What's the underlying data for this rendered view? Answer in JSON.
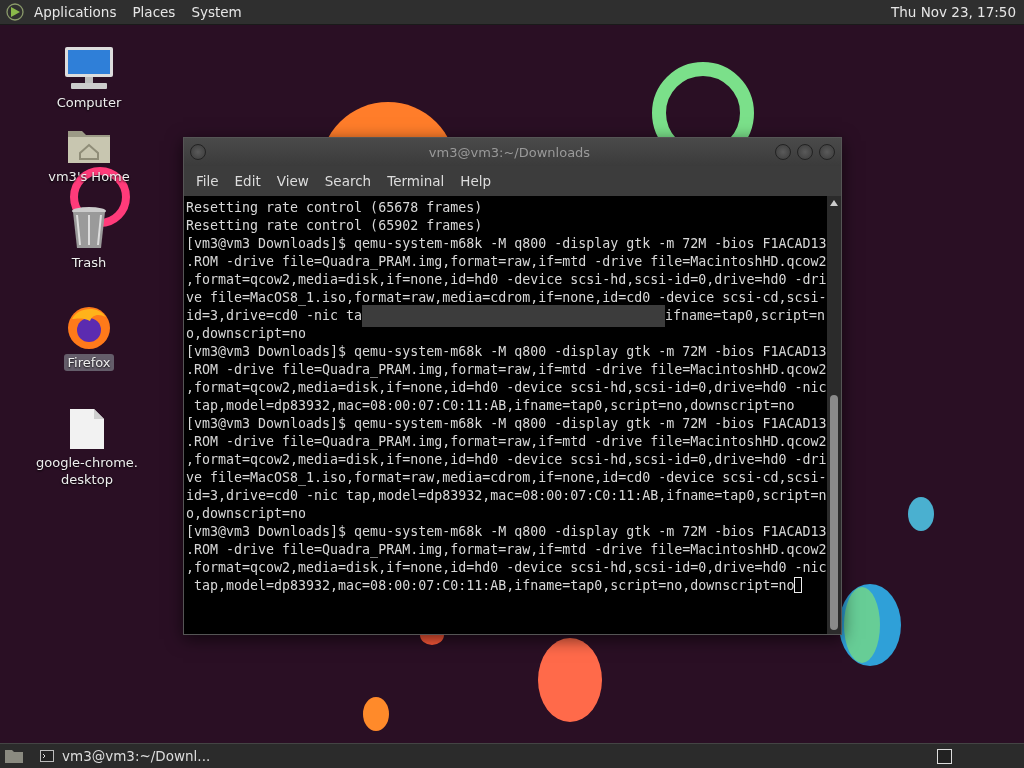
{
  "top_panel": {
    "menus": [
      {
        "label": "Applications"
      },
      {
        "label": "Places"
      },
      {
        "label": "System"
      }
    ],
    "clock": "Thu Nov 23, 17:50"
  },
  "desktop_icons": [
    {
      "label": "Computer",
      "kind": "computer",
      "selected": false
    },
    {
      "label": "vm3's Home",
      "kind": "home",
      "selected": false
    },
    {
      "label": "Trash",
      "kind": "trash",
      "selected": false
    },
    {
      "label": "Firefox",
      "kind": "browser",
      "selected": true
    },
    {
      "label": "google-chrome.\ndesktop",
      "kind": "file",
      "selected": false
    }
  ],
  "terminal": {
    "title": "vm3@vm3:~/Downloads",
    "menu": [
      {
        "label": "File"
      },
      {
        "label": "Edit"
      },
      {
        "label": "View"
      },
      {
        "label": "Search"
      },
      {
        "label": "Terminal"
      },
      {
        "label": "Help"
      }
    ],
    "lines": [
      {
        "kind": "text",
        "text": "Resetting rate control (65678 frames)"
      },
      {
        "kind": "text",
        "text": "Resetting rate control (65902 frames)"
      },
      {
        "kind": "text",
        "text": "[vm3@vm3 Downloads]$ qemu-system-m68k -M q800 -display gtk -m 72M -bios F1ACAD13"
      },
      {
        "kind": "text",
        "text": ".ROM -drive file=Quadra_PRAM.img,format=raw,if=mtd -drive file=MacintoshHD.qcow2"
      },
      {
        "kind": "text",
        "text": ",format=qcow2,media=disk,if=none,id=hd0 -device scsi-hd,scsi-id=0,drive=hd0 -dri"
      },
      {
        "kind": "text",
        "text": "ve file=MacOS8_1.iso,format=raw,media=cdrom,if=none,id=cd0 -device scsi-cd,scsi-"
      },
      {
        "kind": "redacted",
        "before": "id=3,drive=cd0 -nic ta",
        "after": "ifname=tap0,script=n"
      },
      {
        "kind": "text",
        "text": "o,downscript=no"
      },
      {
        "kind": "text",
        "text": "[vm3@vm3 Downloads]$ qemu-system-m68k -M q800 -display gtk -m 72M -bios F1ACAD13"
      },
      {
        "kind": "text",
        "text": ".ROM -drive file=Quadra_PRAM.img,format=raw,if=mtd -drive file=MacintoshHD.qcow2"
      },
      {
        "kind": "text",
        "text": ",format=qcow2,media=disk,if=none,id=hd0 -device scsi-hd,scsi-id=0,drive=hd0 -nic"
      },
      {
        "kind": "text",
        "text": " tap,model=dp83932,mac=08:00:07:C0:11:AB,ifname=tap0,script=no,downscript=no"
      },
      {
        "kind": "text",
        "text": "[vm3@vm3 Downloads]$ qemu-system-m68k -M q800 -display gtk -m 72M -bios F1ACAD13"
      },
      {
        "kind": "text",
        "text": ".ROM -drive file=Quadra_PRAM.img,format=raw,if=mtd -drive file=MacintoshHD.qcow2"
      },
      {
        "kind": "text",
        "text": ",format=qcow2,media=disk,if=none,id=hd0 -device scsi-hd,scsi-id=0,drive=hd0 -dri"
      },
      {
        "kind": "text",
        "text": "ve file=MacOS8_1.iso,format=raw,media=cdrom,if=none,id=cd0 -device scsi-cd,scsi-"
      },
      {
        "kind": "text",
        "text": "id=3,drive=cd0 -nic tap,model=dp83932,mac=08:00:07:C0:11:AB,ifname=tap0,script=n"
      },
      {
        "kind": "text",
        "text": "o,downscript=no"
      },
      {
        "kind": "text",
        "text": "[vm3@vm3 Downloads]$ qemu-system-m68k -M q800 -display gtk -m 72M -bios F1ACAD13"
      },
      {
        "kind": "text",
        "text": ".ROM -drive file=Quadra_PRAM.img,format=raw,if=mtd -drive file=MacintoshHD.qcow2"
      },
      {
        "kind": "text",
        "text": ",format=qcow2,media=disk,if=none,id=hd0 -device scsi-hd,scsi-id=0,drive=hd0 -nic"
      },
      {
        "kind": "prompt",
        "text": " tap,model=dp83932,mac=08:00:07:C0:11:AB,ifname=tap0,script=no,downscript=no"
      }
    ]
  },
  "taskbar": {
    "tasks": [
      {
        "label": "vm3@vm3:~/Downl...",
        "selected": false
      }
    ]
  }
}
